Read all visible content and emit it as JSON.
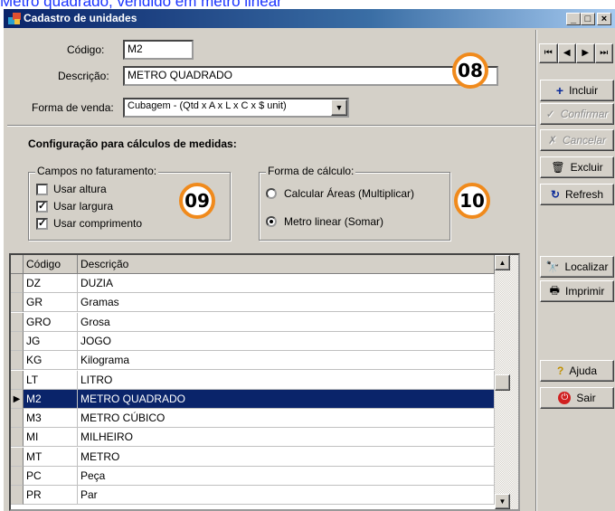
{
  "caption": "Metro quadrado, vendido em metro linear",
  "window": {
    "title": "Cadastro de unidades",
    "controls": {
      "minimize": "_",
      "maximize": "□",
      "close": "×"
    }
  },
  "form": {
    "codigo_label": "Código:",
    "codigo_value": "M2",
    "descricao_label": "Descrição:",
    "descricao_value": "METRO QUADRADO",
    "forma_venda_label": "Forma de venda:",
    "forma_venda_value": "Cubagem - (Qtd x A x L x C x $ unit)",
    "config_heading": "Configuração para cálculos de medidas:",
    "campos_group": {
      "legend": "Campos no faturamento:",
      "items": [
        {
          "label": "Usar altura",
          "checked": false
        },
        {
          "label": "Usar largura",
          "checked": true
        },
        {
          "label": "Usar comprimento",
          "checked": true
        }
      ]
    },
    "forma_calculo_group": {
      "legend": "Forma de cálculo:",
      "options": [
        {
          "label": "Calcular Áreas  (Multiplicar)",
          "selected": false
        },
        {
          "label": "Metro linear  (Somar)",
          "selected": true
        }
      ]
    }
  },
  "badges": {
    "b08": "08",
    "b09": "09",
    "b10": "10"
  },
  "nav_buttons": {
    "first": "⏮",
    "prev": "◀",
    "next": "▶",
    "last": "⏭"
  },
  "side_buttons": {
    "incluir": "Incluir",
    "confirmar": "Confirmar",
    "cancelar": "Cancelar",
    "excluir": "Excluir",
    "refresh": "Refresh",
    "localizar": "Localizar",
    "imprimir": "Imprimir",
    "ajuda": "Ajuda",
    "sair": "Sair"
  },
  "grid": {
    "headers": {
      "codigo": "Código",
      "descricao": "Descrição"
    },
    "selected_index": 6,
    "rows": [
      {
        "codigo": "DZ",
        "descricao": "DUZIA"
      },
      {
        "codigo": "GR",
        "descricao": "Gramas"
      },
      {
        "codigo": "GRO",
        "descricao": "Grosa"
      },
      {
        "codigo": "JG",
        "descricao": "JOGO"
      },
      {
        "codigo": "KG",
        "descricao": "Kilograma"
      },
      {
        "codigo": "LT",
        "descricao": "LITRO"
      },
      {
        "codigo": "M2",
        "descricao": "METRO QUADRADO"
      },
      {
        "codigo": "M3",
        "descricao": "METRO CÚBICO"
      },
      {
        "codigo": "MI",
        "descricao": "MILHEIRO"
      },
      {
        "codigo": "MT",
        "descricao": "METRO"
      },
      {
        "codigo": "PC",
        "descricao": "Peça"
      },
      {
        "codigo": "PR",
        "descricao": "Par"
      }
    ]
  },
  "colors": {
    "badge_ring": "#f08a1c",
    "selection": "#0a246a",
    "caption": "#1a33ff"
  }
}
